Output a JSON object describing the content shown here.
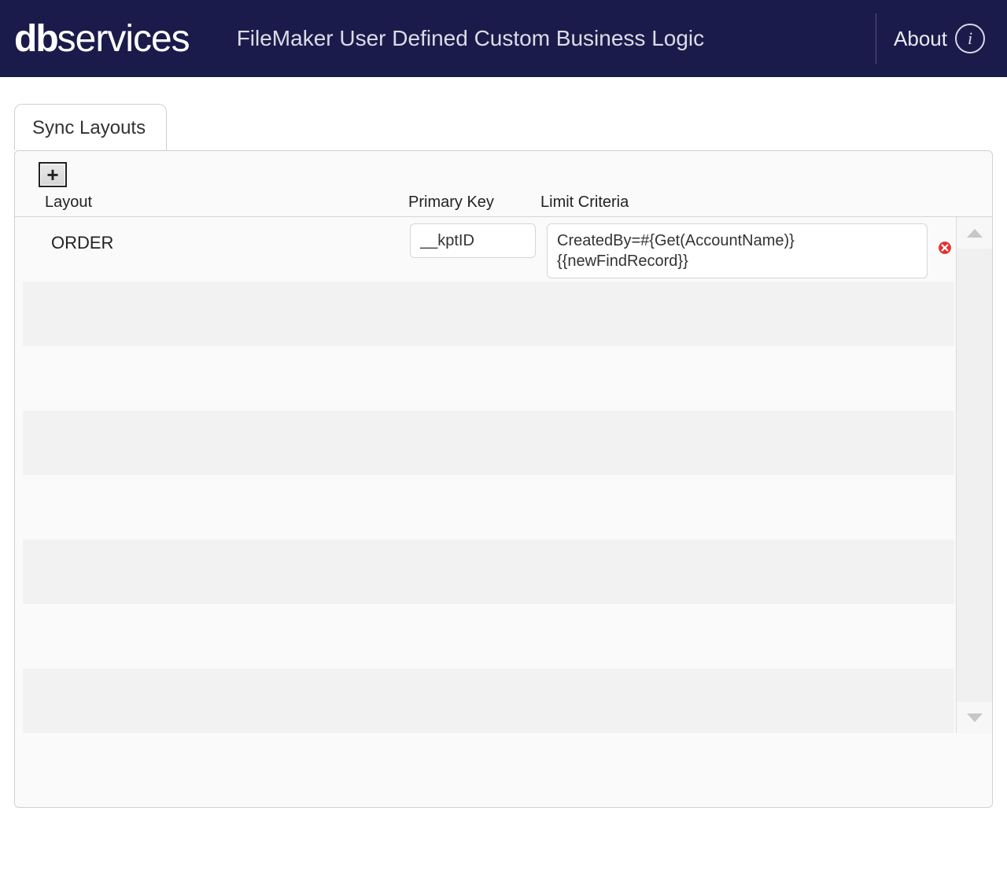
{
  "header": {
    "logo_bold": "db",
    "logo_thin": "services",
    "title": "FileMaker User Defined Custom Business Logic",
    "about_label": "About",
    "info_glyph": "i"
  },
  "tabs": {
    "sync_layouts": "Sync Layouts"
  },
  "toolbar": {
    "add_glyph": "+"
  },
  "columns": {
    "layout": "Layout",
    "primary_key": "Primary Key",
    "limit_criteria": "Limit Criteria"
  },
  "rows": [
    {
      "layout": "ORDER",
      "primary_key": "__kptID",
      "limit_criteria": "CreatedBy=#{Get(AccountName)}\n{{newFindRecord}}"
    }
  ],
  "empty_rows_count": 7
}
